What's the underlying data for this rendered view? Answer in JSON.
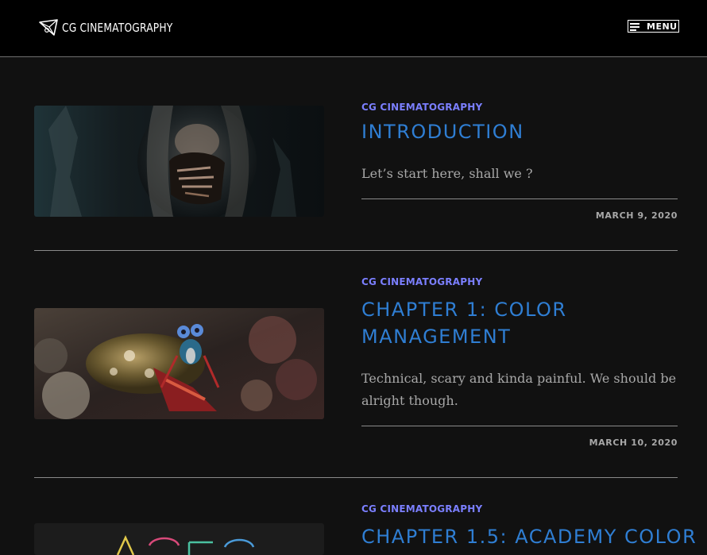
{
  "header": {
    "site_name": "CG CINEMATOGRAPHY",
    "logo_icon": "camera-triangle-icon",
    "menu_label": "MENU",
    "menu_icon": "hamburger-icon"
  },
  "colors": {
    "background": "#111111",
    "header_background": "#000000",
    "category": "#7b7fff",
    "title": "#2f7ed3",
    "text": "#a8a8a8",
    "divider": "#8a8a8a"
  },
  "posts": [
    {
      "category": "CG CINEMATOGRAPHY",
      "title": "INTRODUCTION",
      "excerpt": "Let’s start here, shall we ?",
      "date": "MARCH 9, 2020",
      "thumbnail": "film-still-man-hand-over-mouth"
    },
    {
      "category": "CG CINEMATOGRAPHY",
      "title_line1": "CHAPTER 1: COLOR",
      "title_line2": "MANAGEMENT",
      "excerpt_line1": "Technical, scary and kinda painful. We should be",
      "excerpt_line2": "alright though.",
      "date": "MARCH 10, 2020",
      "thumbnail": "mantis-shrimp-coral-reef"
    },
    {
      "category": "CG CINEMATOGRAPHY",
      "title": "CHAPTER 1.5: ACADEMY COLOR",
      "thumbnail": "aces-logo"
    }
  ]
}
